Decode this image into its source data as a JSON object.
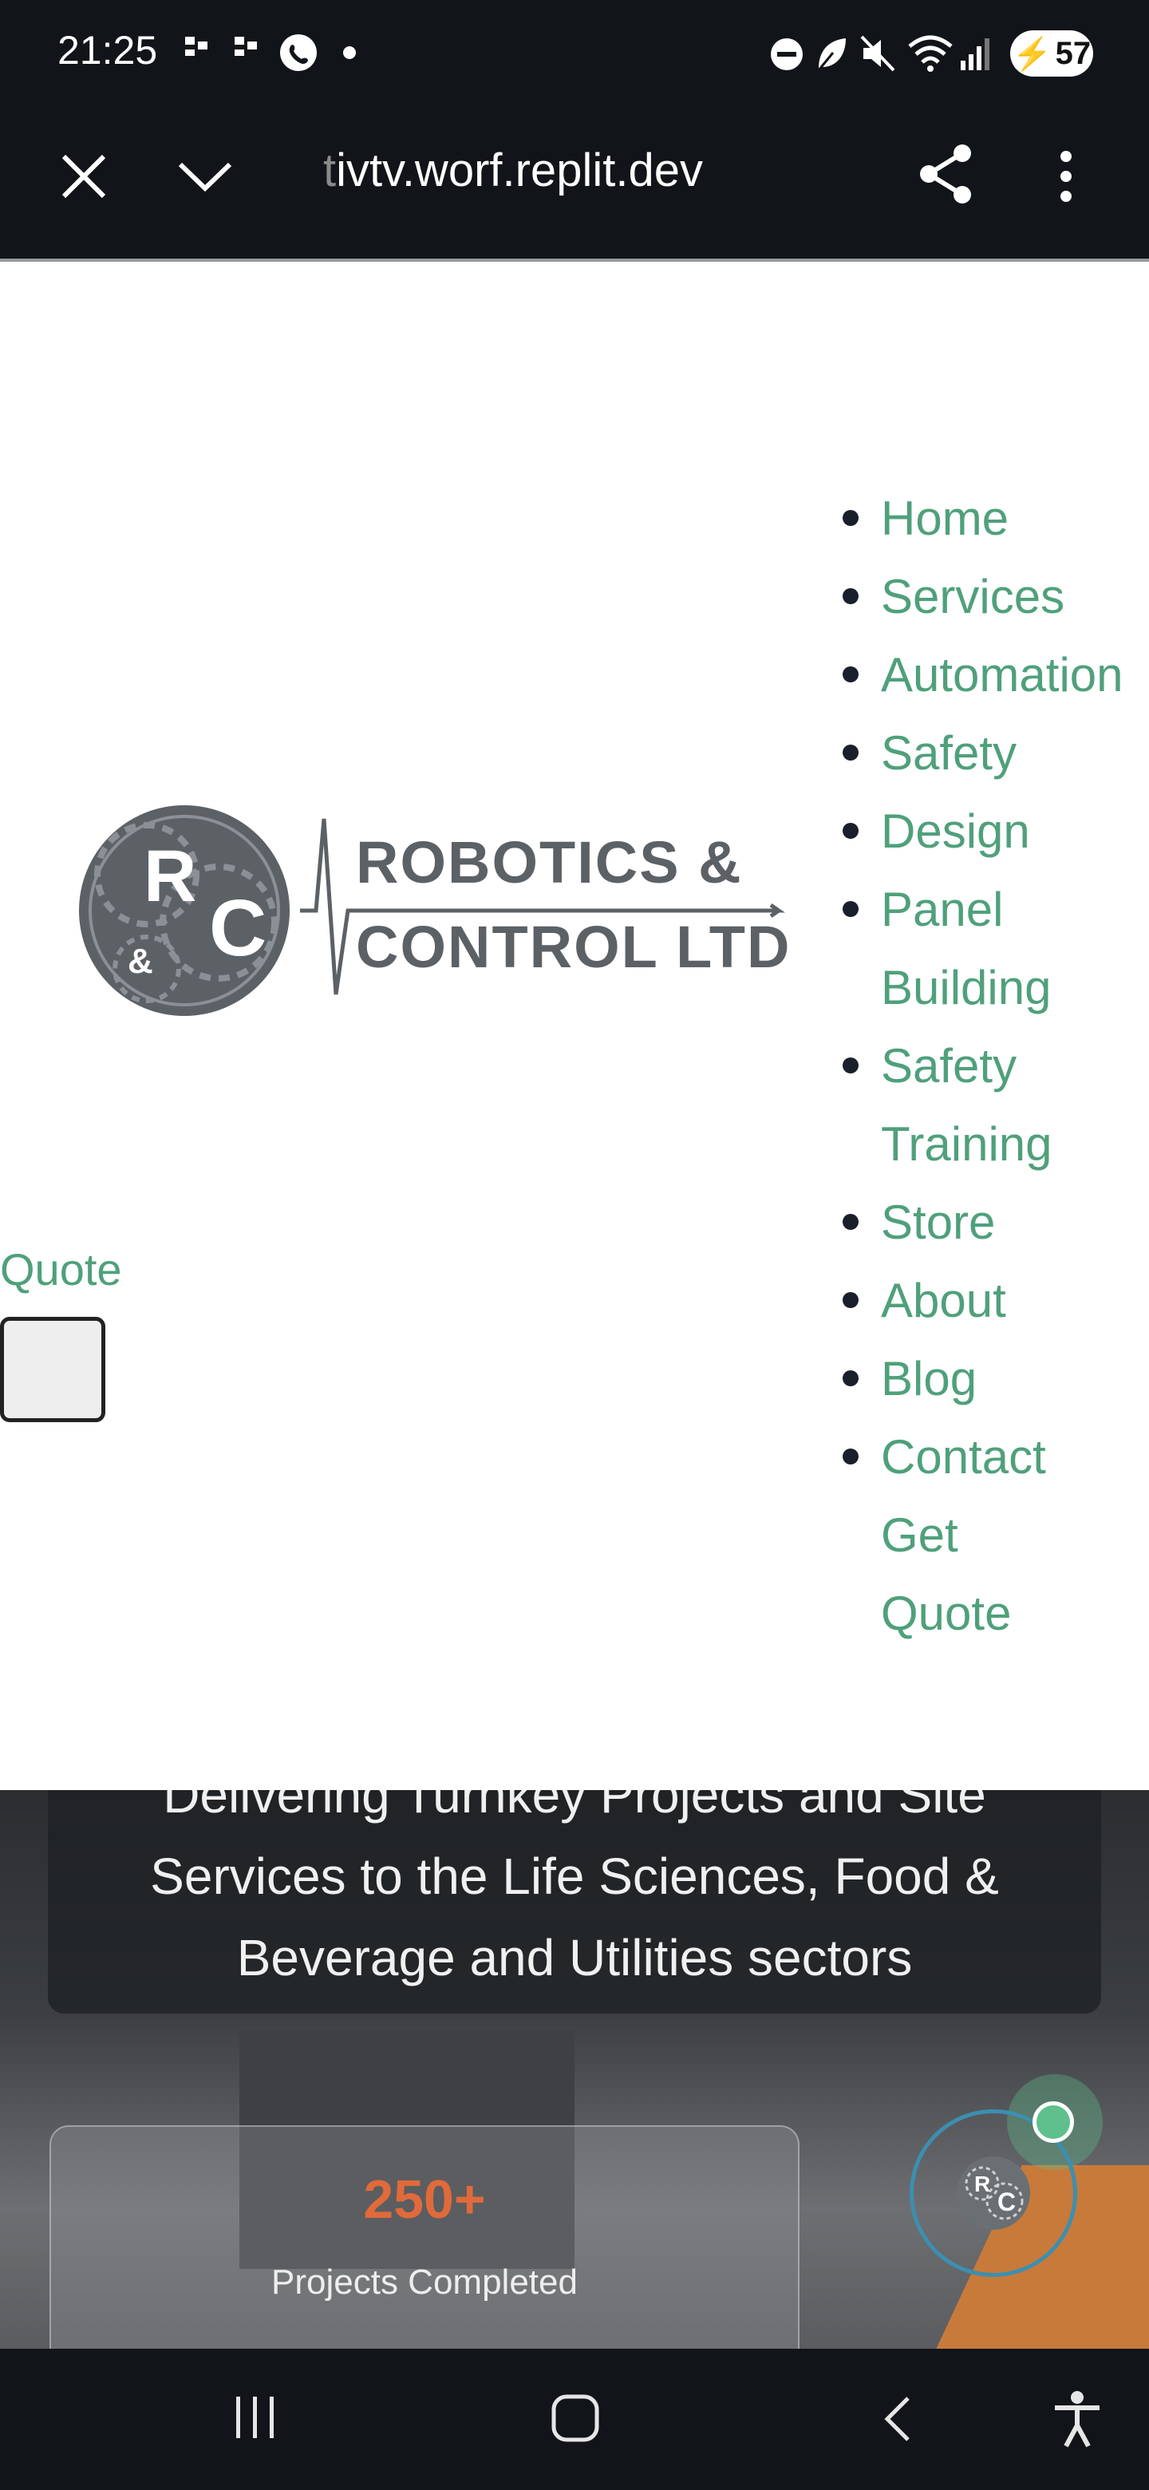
{
  "status_bar": {
    "time": "21:25",
    "battery": "57",
    "left_icons": [
      "notification-icon",
      "notification-icon",
      "whatsapp-icon",
      "dot-icon"
    ],
    "right_icons": [
      "dnd-icon",
      "leaf-icon",
      "mute-icon",
      "wifi-icon",
      "signal-icon",
      "battery-icon"
    ]
  },
  "browser": {
    "url_fade": "t",
    "url": "ivtv.worf.replit.dev",
    "close_icon": "close-icon",
    "collapse_icon": "chevron-down-icon",
    "share_icon": "share-icon",
    "menu_icon": "more-vert-icon"
  },
  "logo": {
    "line1": "ROBOTICS &",
    "line2": "CONTROL LTD",
    "mark_r": "R",
    "mark_c": "C",
    "mark_amp": "&"
  },
  "nav": {
    "items": [
      {
        "label": "Home"
      },
      {
        "label": "Services"
      },
      {
        "label": "Automation"
      },
      {
        "label": "Safety"
      },
      {
        "label": "Design"
      },
      {
        "label": "Panel"
      },
      {
        "label": "Building"
      },
      {
        "label": "Safety"
      },
      {
        "label": "Training"
      },
      {
        "label": "Store"
      },
      {
        "label": "About"
      },
      {
        "label": "Blog"
      },
      {
        "label": "Contact"
      },
      {
        "label": "Get Quote"
      }
    ]
  },
  "quote_link": "Quote",
  "hero": {
    "tagline_line1": "Delivering Turnkey Projects and Site",
    "tagline_line2": "Services to the Life Sciences, Food &",
    "tagline_line3": "Beverage and Utilities sectors",
    "stat_value": "250+",
    "stat_label": "Projects Completed"
  },
  "colors": {
    "nav_green": "#4fa07b",
    "stat_orange": "#e06a3a",
    "chat_ring": "#3c8fb0"
  }
}
